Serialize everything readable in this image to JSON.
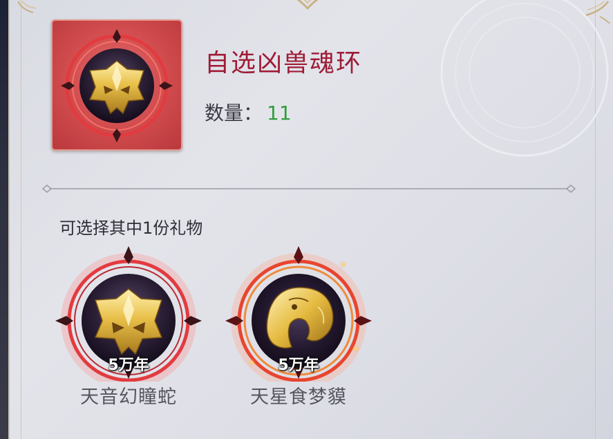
{
  "item": {
    "name": "自选凶兽魂环",
    "quantity_label": "数量：",
    "quantity_value": "11",
    "icon": "golden-dragon-mask-soul-ring-icon"
  },
  "section": {
    "prompt": "可选择其中1份礼物"
  },
  "rewards": [
    {
      "name": "天音幻瞳蛇",
      "years": "5万年",
      "icon": "golden-dragon-mask-soul-ring-icon"
    },
    {
      "name": "天星食梦貘",
      "years": "5万年",
      "icon": "golden-tapir-soul-ring-icon"
    }
  ],
  "colors": {
    "title": "#9e1b36",
    "quantity": "#2f9d3a",
    "ring_red": "#d8343a",
    "gold": "#e8c04a"
  }
}
